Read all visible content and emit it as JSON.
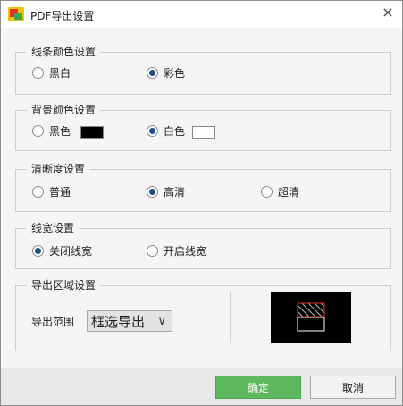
{
  "dialog": {
    "title": "PDF导出设置",
    "close_glyph": "×"
  },
  "line_color": {
    "legend": "线条颜色设置",
    "options": [
      {
        "label": "黑白",
        "selected": false
      },
      {
        "label": "彩色",
        "selected": true
      }
    ]
  },
  "bg_color": {
    "legend": "背景颜色设置",
    "options": [
      {
        "label": "黑色",
        "selected": false,
        "swatch": "#000000"
      },
      {
        "label": "白色",
        "selected": true,
        "swatch": "#ffffff"
      }
    ]
  },
  "clarity": {
    "legend": "清晰度设置",
    "options": [
      {
        "label": "普通",
        "selected": false
      },
      {
        "label": "高清",
        "selected": true
      },
      {
        "label": "超清",
        "selected": false
      }
    ]
  },
  "line_width": {
    "legend": "线宽设置",
    "options": [
      {
        "label": "关闭线宽",
        "selected": true
      },
      {
        "label": "开启线宽",
        "selected": false
      }
    ]
  },
  "export_area": {
    "legend": "导出区域设置",
    "range_label": "导出范围",
    "range_value": "框选导出",
    "range_arrow": "∨"
  },
  "footer": {
    "ok_label": "确定",
    "cancel_label": "取消"
  },
  "colors": {
    "accent": "#5eb95e",
    "radio_dot": "#1f4e8c",
    "preview_bg": "#000000",
    "preview_frame": "#e03030"
  }
}
